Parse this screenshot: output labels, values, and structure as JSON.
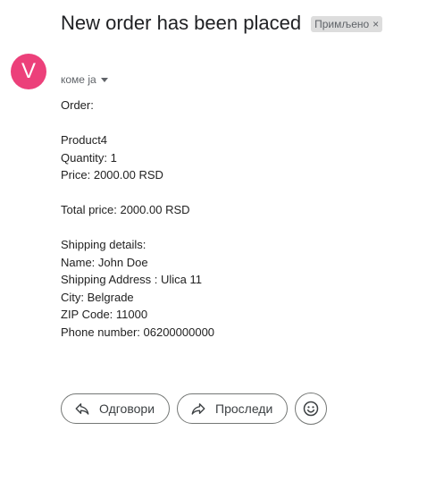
{
  "email": {
    "subject": "New order has been placed",
    "label": "Примљено",
    "label_remove": "×",
    "sender_initial": "V",
    "recipient": "коме ја",
    "body_lines": [
      "Order:",
      "",
      "Product4",
      "Quantity: 1",
      "Price: 2000.00 RSD",
      "",
      "Total price: 2000.00 RSD",
      "",
      "Shipping details:",
      "Name: John Doe",
      "Shipping Address : Ulica 11",
      "City: Belgrade",
      "ZIP Code: 11000",
      "Phone number: 06200000000"
    ]
  },
  "actions": {
    "reply_label": "Одговори",
    "forward_label": "Проследи"
  },
  "icons": {
    "reply": "reply-arrow-icon",
    "forward": "forward-arrow-icon",
    "emoji": "smiley-icon",
    "dropdown": "chevron-down-icon"
  },
  "colors": {
    "avatar": "#ec407a",
    "chip": "#dddddd",
    "text": "#202124",
    "muted": "#5f6368"
  }
}
